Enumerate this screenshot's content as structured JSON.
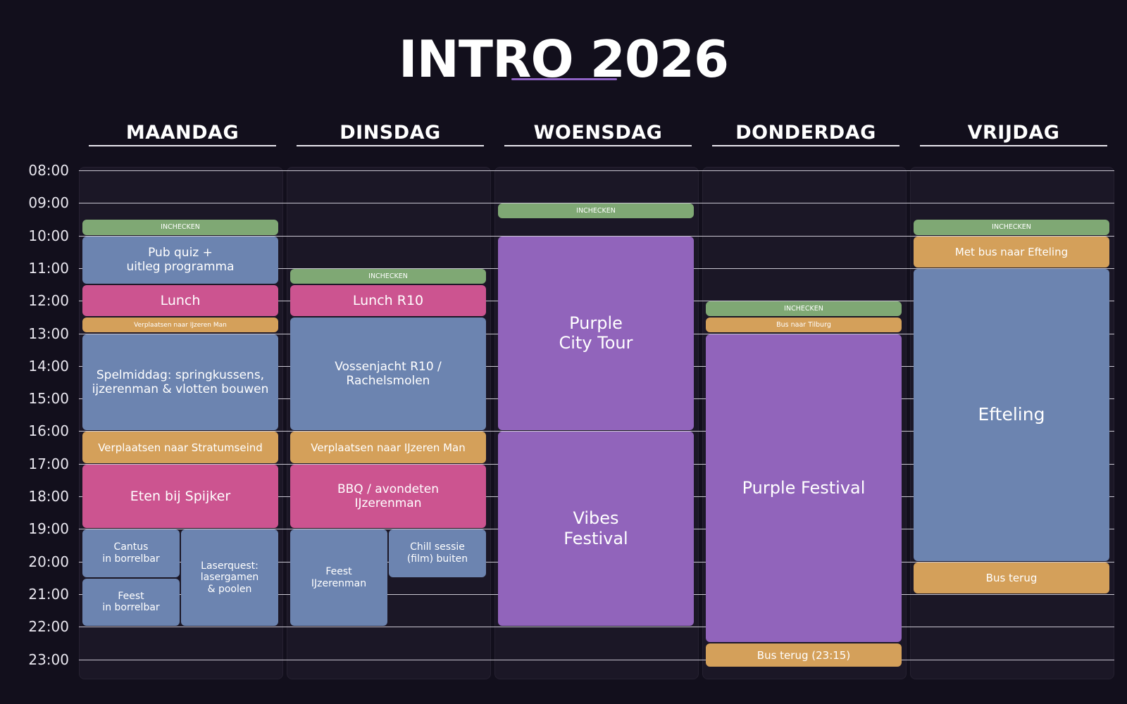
{
  "header": {
    "title": "INTRO 2026"
  },
  "colors": {
    "checkin": "#7fa874",
    "transport": "#d4a05a",
    "activity": "#6c84b0",
    "meal": "#cc5490",
    "purple": "#9164bb",
    "accent": "#8e62c4"
  },
  "days": [
    "MAANDAG",
    "DINSDAG",
    "WOENSDAG",
    "DONDERDAG",
    "VRIJDAG"
  ],
  "hours": [
    "08:00",
    "09:00",
    "10:00",
    "11:00",
    "12:00",
    "13:00",
    "14:00",
    "15:00",
    "16:00",
    "17:00",
    "18:00",
    "19:00",
    "20:00",
    "21:00",
    "22:00",
    "23:00"
  ],
  "events": [
    {
      "day": 0,
      "start": "09:30",
      "end": "10:00",
      "label": "INCHECKEN",
      "kind": "checkin"
    },
    {
      "day": 0,
      "start": "10:00",
      "end": "11:30",
      "label": "Pub quiz +\nuitleg programma",
      "kind": "activity"
    },
    {
      "day": 0,
      "start": "11:30",
      "end": "12:30",
      "label": "Lunch",
      "kind": "meal"
    },
    {
      "day": 0,
      "start": "12:30",
      "end": "13:00",
      "label": "Verplaatsen naar IJzeren Man",
      "kind": "transport"
    },
    {
      "day": 0,
      "start": "13:00",
      "end": "16:00",
      "label": "Spelmiddag: springkussens,\nijzerenman & vlotten bouwen",
      "kind": "activity"
    },
    {
      "day": 0,
      "start": "16:00",
      "end": "17:00",
      "label": "Verplaatsen naar Stratumseind",
      "kind": "transport"
    },
    {
      "day": 0,
      "start": "17:00",
      "end": "19:00",
      "label": "Eten bij Spijker",
      "kind": "meal"
    },
    {
      "day": 0,
      "start": "19:00",
      "end": "20:30",
      "label": "Cantus\nin borrelbar",
      "kind": "activity",
      "slot": 0,
      "slots": 2
    },
    {
      "day": 0,
      "start": "20:30",
      "end": "22:00",
      "label": "Feest\nin borrelbar",
      "kind": "activity",
      "slot": 0,
      "slots": 2
    },
    {
      "day": 0,
      "start": "19:00",
      "end": "22:00",
      "label": "Laserquest:\nlasergamen\n& poolen",
      "kind": "activity",
      "slot": 1,
      "slots": 2
    },
    {
      "day": 1,
      "start": "11:00",
      "end": "11:30",
      "label": "INCHECKEN",
      "kind": "checkin"
    },
    {
      "day": 1,
      "start": "11:30",
      "end": "12:30",
      "label": "Lunch R10",
      "kind": "meal"
    },
    {
      "day": 1,
      "start": "12:30",
      "end": "16:00",
      "label": "Vossenjacht R10 /\nRachelsmolen",
      "kind": "activity"
    },
    {
      "day": 1,
      "start": "16:00",
      "end": "17:00",
      "label": "Verplaatsen naar IJzeren Man",
      "kind": "transport"
    },
    {
      "day": 1,
      "start": "17:00",
      "end": "19:00",
      "label": "BBQ / avondeten\nIJzerenman",
      "kind": "meal"
    },
    {
      "day": 1,
      "start": "19:00",
      "end": "22:00",
      "label": "Feest\nIJzerenman",
      "kind": "activity",
      "slot": 0,
      "slots": 2
    },
    {
      "day": 1,
      "start": "19:00",
      "end": "20:30",
      "label": "Chill sessie\n(film) buiten",
      "kind": "activity",
      "slot": 1,
      "slots": 2
    },
    {
      "day": 2,
      "start": "09:00",
      "end": "09:30",
      "label": "INCHECKEN",
      "kind": "checkin"
    },
    {
      "day": 2,
      "start": "10:00",
      "end": "16:00",
      "label": "Purple\nCity Tour",
      "kind": "purple"
    },
    {
      "day": 2,
      "start": "16:00",
      "end": "22:00",
      "label": "Vibes\nFestival",
      "kind": "purple"
    },
    {
      "day": 3,
      "start": "12:00",
      "end": "12:30",
      "label": "INCHECKEN",
      "kind": "checkin"
    },
    {
      "day": 3,
      "start": "12:30",
      "end": "13:00",
      "label": "Bus naar Tilburg",
      "kind": "transport"
    },
    {
      "day": 3,
      "start": "13:00",
      "end": "22:30",
      "label": "Purple Festival",
      "kind": "purple"
    },
    {
      "day": 3,
      "start": "22:30",
      "end": "23:15",
      "label": "Bus terug (23:15)",
      "kind": "transport"
    },
    {
      "day": 4,
      "start": "09:30",
      "end": "10:00",
      "label": "INCHECKEN",
      "kind": "checkin"
    },
    {
      "day": 4,
      "start": "10:00",
      "end": "11:00",
      "label": "Met bus naar Efteling",
      "kind": "transport"
    },
    {
      "day": 4,
      "start": "11:00",
      "end": "20:00",
      "label": "Efteling",
      "kind": "activity"
    },
    {
      "day": 4,
      "start": "20:00",
      "end": "21:00",
      "label": "Bus terug",
      "kind": "transport"
    }
  ]
}
